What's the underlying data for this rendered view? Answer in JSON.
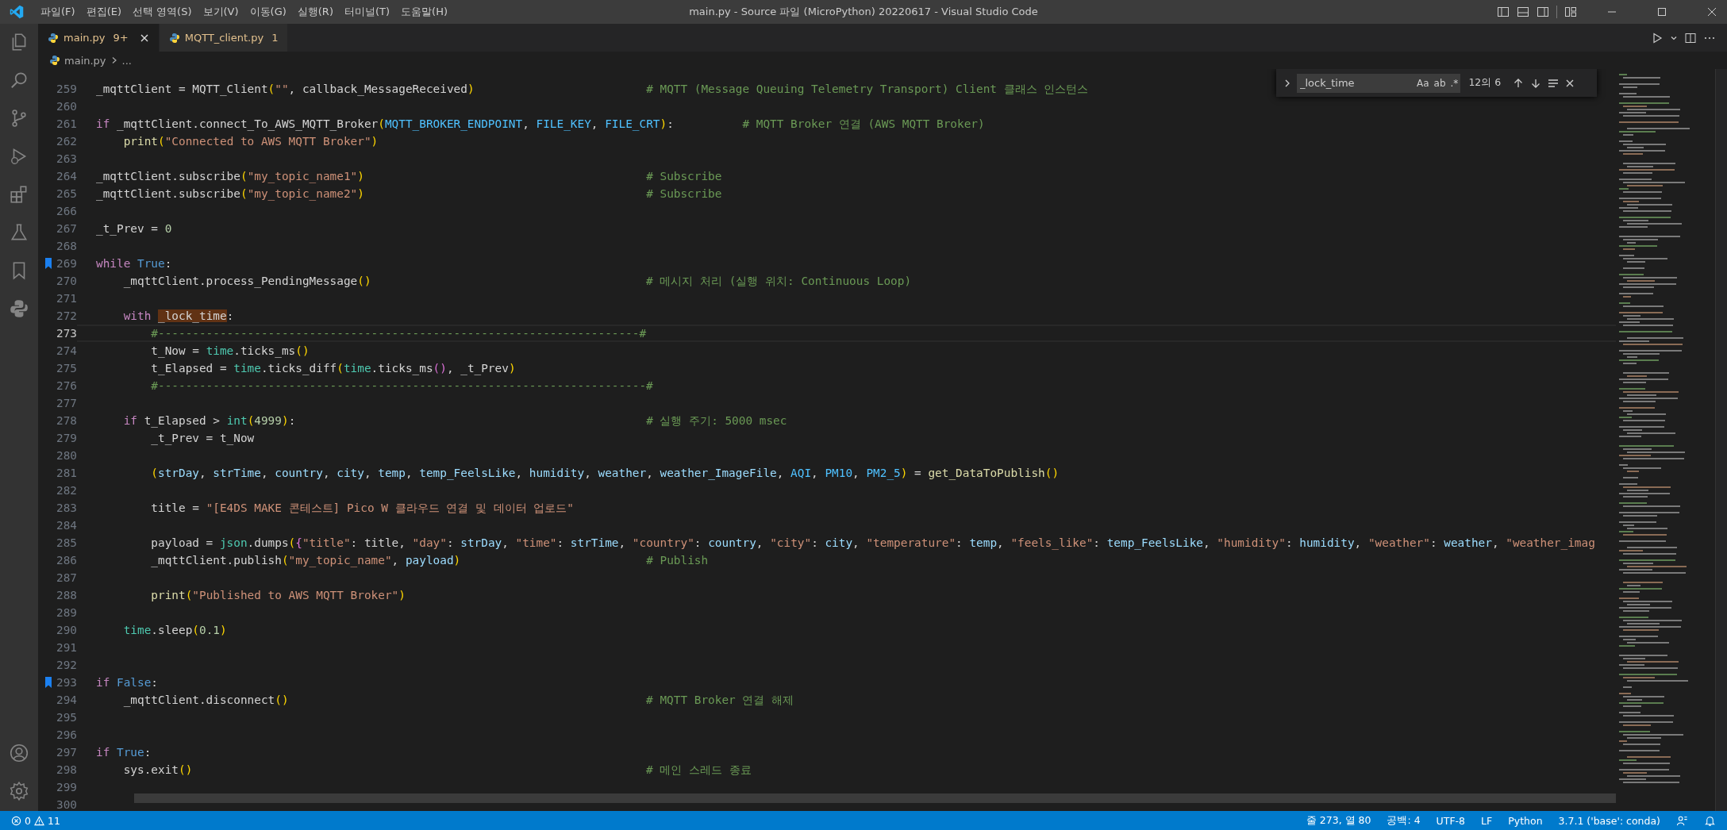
{
  "window": {
    "title": "main.py - Source 파일 (MicroPython) 20220617 - Visual Studio Code"
  },
  "menu": [
    "파일(F)",
    "편집(E)",
    "선택 영역(S)",
    "보기(V)",
    "이동(G)",
    "실행(R)",
    "터미널(T)",
    "도움말(H)"
  ],
  "tabs": [
    {
      "label": "main.py",
      "badge": "9+",
      "selected": true
    },
    {
      "label": "MQTT_client.py",
      "badge": "1",
      "selected": false
    }
  ],
  "breadcrumb": [
    "main.py",
    "..."
  ],
  "find": {
    "value": "_lock_time",
    "options": [
      "Aa",
      "ab",
      ".*"
    ],
    "result": "12의 6"
  },
  "editor": {
    "lines": [
      {
        "number": "259",
        "current": false,
        "bookmarked": false,
        "tokens": [
          {
            "kind": "plain",
            "text": "_mqttClient = MQTT_Client"
          },
          {
            "kind": "p1",
            "text": "("
          },
          {
            "kind": "str",
            "text": "\"\""
          },
          {
            "kind": "plain",
            "text": ", callback_MessageReceived"
          },
          {
            "kind": "p1",
            "text": ")"
          }
        ],
        "comment": "# MQTT (Message Queuing Telemetry Transport) Client 클래스 인스턴스"
      },
      {
        "number": "260",
        "current": false,
        "bookmarked": false
      },
      {
        "number": "261",
        "current": false,
        "bookmarked": false,
        "tokens": [
          {
            "kind": "kw",
            "text": "if"
          },
          {
            "kind": "plain",
            "text": " _mqttClient.connect_To_AWS_MQTT_Broker"
          },
          {
            "kind": "p1",
            "text": "("
          },
          {
            "kind": "konst",
            "text": "MQTT_BROKER_ENDPOINT"
          },
          {
            "kind": "plain",
            "text": ", "
          },
          {
            "kind": "konst",
            "text": "FILE_KEY"
          },
          {
            "kind": "plain",
            "text": ", "
          },
          {
            "kind": "konst",
            "text": "FILE_CRT"
          },
          {
            "kind": "p1",
            "text": ")"
          },
          {
            "kind": "plain",
            "text": ":"
          }
        ],
        "comment": "# MQTT Broker 연결 (AWS MQTT Broker)"
      },
      {
        "number": "262",
        "current": false,
        "bookmarked": false,
        "tokens": [
          {
            "kind": "fn",
            "text": "    print"
          },
          {
            "kind": "p1",
            "text": "("
          },
          {
            "kind": "str",
            "text": "\"Connected to AWS MQTT Broker\""
          },
          {
            "kind": "p1",
            "text": ")"
          }
        ]
      },
      {
        "number": "263",
        "current": false,
        "bookmarked": false
      },
      {
        "number": "264",
        "current": false,
        "bookmarked": false,
        "tokens": [
          {
            "kind": "plain",
            "text": "_mqttClient.subscribe"
          },
          {
            "kind": "p1",
            "text": "("
          },
          {
            "kind": "str",
            "text": "\"my_topic_name1\""
          },
          {
            "kind": "p1",
            "text": ")"
          }
        ],
        "comment": "# Subscribe"
      },
      {
        "number": "265",
        "current": false,
        "bookmarked": false,
        "tokens": [
          {
            "kind": "plain",
            "text": "_mqttClient.subscribe"
          },
          {
            "kind": "p1",
            "text": "("
          },
          {
            "kind": "str",
            "text": "\"my_topic_name2\""
          },
          {
            "kind": "p1",
            "text": ")"
          }
        ],
        "comment": "# Subscribe"
      },
      {
        "number": "266",
        "current": false,
        "bookmarked": false
      },
      {
        "number": "267",
        "current": false,
        "bookmarked": false,
        "tokens": [
          {
            "kind": "plain",
            "text": "_t_Prev = "
          },
          {
            "kind": "num",
            "text": "0"
          }
        ]
      },
      {
        "number": "268",
        "current": false,
        "bookmarked": false
      },
      {
        "number": "269",
        "current": false,
        "bookmarked": true,
        "tokens": [
          {
            "kind": "kw",
            "text": "while "
          },
          {
            "kind": "const",
            "text": "True"
          },
          {
            "kind": "plain",
            "text": ":"
          }
        ]
      },
      {
        "number": "270",
        "current": false,
        "bookmarked": false,
        "tokens": [
          {
            "kind": "plain",
            "text": "    _mqttClient.process_PendingMessage"
          },
          {
            "kind": "p1",
            "text": "()"
          }
        ],
        "comment": "# 메시지 처리 (실행 위치: Continuous Loop)"
      },
      {
        "number": "271",
        "current": false,
        "bookmarked": false
      },
      {
        "number": "272",
        "current": false,
        "bookmarked": false,
        "tokens": [
          {
            "kind": "kw",
            "text": "    with "
          },
          {
            "kind": "match",
            "text": "_lock_time"
          },
          {
            "kind": "plain",
            "text": ":"
          }
        ]
      },
      {
        "number": "273",
        "current": true,
        "bookmarked": false,
        "tokens": [
          {
            "kind": "cmt",
            "text": "        #----------------------------------------------------------------------#"
          }
        ]
      },
      {
        "number": "274",
        "current": false,
        "bookmarked": false,
        "tokens": [
          {
            "kind": "plain",
            "text": "        t_Now = "
          },
          {
            "kind": "cls",
            "text": "time"
          },
          {
            "kind": "plain",
            "text": ".ticks_ms"
          },
          {
            "kind": "p1",
            "text": "()"
          }
        ]
      },
      {
        "number": "275",
        "current": false,
        "bookmarked": false,
        "tokens": [
          {
            "kind": "plain",
            "text": "        t_Elapsed = "
          },
          {
            "kind": "cls",
            "text": "time"
          },
          {
            "kind": "plain",
            "text": ".ticks_diff"
          },
          {
            "kind": "p1",
            "text": "("
          },
          {
            "kind": "cls",
            "text": "time"
          },
          {
            "kind": "plain",
            "text": ".ticks_ms"
          },
          {
            "kind": "p2",
            "text": "()"
          },
          {
            "kind": "plain",
            "text": ", _t_Prev"
          },
          {
            "kind": "p1",
            "text": ")"
          }
        ]
      },
      {
        "number": "276",
        "current": false,
        "bookmarked": false,
        "tokens": [
          {
            "kind": "cmt",
            "text": "        #-----------------------------------------------------------------------#"
          }
        ]
      },
      {
        "number": "277",
        "current": false,
        "bookmarked": false
      },
      {
        "number": "278",
        "current": false,
        "bookmarked": false,
        "tokens": [
          {
            "kind": "kw",
            "text": "    if"
          },
          {
            "kind": "plain",
            "text": " t_Elapsed > "
          },
          {
            "kind": "cls",
            "text": "int"
          },
          {
            "kind": "p1",
            "text": "("
          },
          {
            "kind": "num",
            "text": "4999"
          },
          {
            "kind": "p1",
            "text": ")"
          },
          {
            "kind": "plain",
            "text": ":"
          }
        ],
        "comment": "# 실행 주기: 5000 msec"
      },
      {
        "number": "279",
        "current": false,
        "bookmarked": false,
        "tokens": [
          {
            "kind": "plain",
            "text": "        _t_Prev = t_Now"
          }
        ]
      },
      {
        "number": "280",
        "current": false,
        "bookmarked": false
      },
      {
        "number": "281",
        "current": false,
        "bookmarked": false,
        "tokens": [
          {
            "kind": "p1",
            "text": "        ("
          },
          {
            "kind": "var",
            "text": "strDay"
          },
          {
            "kind": "plain",
            "text": ", "
          },
          {
            "kind": "var",
            "text": "strTime"
          },
          {
            "kind": "plain",
            "text": ", "
          },
          {
            "kind": "var",
            "text": "country"
          },
          {
            "kind": "plain",
            "text": ", "
          },
          {
            "kind": "var",
            "text": "city"
          },
          {
            "kind": "plain",
            "text": ", "
          },
          {
            "kind": "var",
            "text": "temp"
          },
          {
            "kind": "plain",
            "text": ", "
          },
          {
            "kind": "var",
            "text": "temp_FeelsLike"
          },
          {
            "kind": "plain",
            "text": ", "
          },
          {
            "kind": "var",
            "text": "humidity"
          },
          {
            "kind": "plain",
            "text": ", "
          },
          {
            "kind": "var",
            "text": "weather"
          },
          {
            "kind": "plain",
            "text": ", "
          },
          {
            "kind": "var",
            "text": "weather_ImageFile"
          },
          {
            "kind": "plain",
            "text": ", "
          },
          {
            "kind": "konst",
            "text": "AQI"
          },
          {
            "kind": "plain",
            "text": ", "
          },
          {
            "kind": "konst",
            "text": "PM10"
          },
          {
            "kind": "plain",
            "text": ", "
          },
          {
            "kind": "konst",
            "text": "PM2_5"
          },
          {
            "kind": "p1",
            "text": ")"
          },
          {
            "kind": "plain",
            "text": " = "
          },
          {
            "kind": "fn",
            "text": "get_DataToPublish"
          },
          {
            "kind": "p1",
            "text": "()"
          }
        ]
      },
      {
        "number": "282",
        "current": false,
        "bookmarked": false
      },
      {
        "number": "283",
        "current": false,
        "bookmarked": false,
        "tokens": [
          {
            "kind": "plain",
            "text": "        title = "
          },
          {
            "kind": "str",
            "text": "\"[E4DS MAKE 콘테스트] Pico W 클라우드 연결 및 데이터 업로드\""
          }
        ]
      },
      {
        "number": "284",
        "current": false,
        "bookmarked": false
      },
      {
        "number": "285",
        "current": false,
        "bookmarked": false,
        "tokens": [
          {
            "kind": "plain",
            "text": "        payload = "
          },
          {
            "kind": "cls",
            "text": "json"
          },
          {
            "kind": "plain",
            "text": ".dumps"
          },
          {
            "kind": "p1",
            "text": "("
          },
          {
            "kind": "p2",
            "text": "{"
          },
          {
            "kind": "str",
            "text": "\"title\""
          },
          {
            "kind": "plain",
            "text": ": title, "
          },
          {
            "kind": "str",
            "text": "\"day\""
          },
          {
            "kind": "plain",
            "text": ": "
          },
          {
            "kind": "var",
            "text": "strDay"
          },
          {
            "kind": "plain",
            "text": ", "
          },
          {
            "kind": "str",
            "text": "\"time\""
          },
          {
            "kind": "plain",
            "text": ": "
          },
          {
            "kind": "var",
            "text": "strTime"
          },
          {
            "kind": "plain",
            "text": ", "
          },
          {
            "kind": "str",
            "text": "\"country\""
          },
          {
            "kind": "plain",
            "text": ": "
          },
          {
            "kind": "var",
            "text": "country"
          },
          {
            "kind": "plain",
            "text": ", "
          },
          {
            "kind": "str",
            "text": "\"city\""
          },
          {
            "kind": "plain",
            "text": ": "
          },
          {
            "kind": "var",
            "text": "city"
          },
          {
            "kind": "plain",
            "text": ", "
          },
          {
            "kind": "str",
            "text": "\"temperature\""
          },
          {
            "kind": "plain",
            "text": ": "
          },
          {
            "kind": "var",
            "text": "temp"
          },
          {
            "kind": "plain",
            "text": ", "
          },
          {
            "kind": "str",
            "text": "\"feels_like\""
          },
          {
            "kind": "plain",
            "text": ": "
          },
          {
            "kind": "var",
            "text": "temp_FeelsLike"
          },
          {
            "kind": "plain",
            "text": ", "
          },
          {
            "kind": "str",
            "text": "\"humidity\""
          },
          {
            "kind": "plain",
            "text": ": "
          },
          {
            "kind": "var",
            "text": "humidity"
          },
          {
            "kind": "plain",
            "text": ", "
          },
          {
            "kind": "str",
            "text": "\"weather\""
          },
          {
            "kind": "plain",
            "text": ": "
          },
          {
            "kind": "var",
            "text": "weather"
          },
          {
            "kind": "plain",
            "text": ", "
          },
          {
            "kind": "str",
            "text": "\"weather_imag"
          }
        ]
      },
      {
        "number": "286",
        "current": false,
        "bookmarked": false,
        "tokens": [
          {
            "kind": "plain",
            "text": "        _mqttClient.publish"
          },
          {
            "kind": "p1",
            "text": "("
          },
          {
            "kind": "str",
            "text": "\"my_topic_name\""
          },
          {
            "kind": "plain",
            "text": ", "
          },
          {
            "kind": "var",
            "text": "payload"
          },
          {
            "kind": "p1",
            "text": ")"
          }
        ],
        "comment": "# Publish"
      },
      {
        "number": "287",
        "current": false,
        "bookmarked": false
      },
      {
        "number": "288",
        "current": false,
        "bookmarked": false,
        "tokens": [
          {
            "kind": "fn",
            "text": "        print"
          },
          {
            "kind": "p1",
            "text": "("
          },
          {
            "kind": "str",
            "text": "\"Published to AWS MQTT Broker\""
          },
          {
            "kind": "p1",
            "text": ")"
          }
        ]
      },
      {
        "number": "289",
        "current": false,
        "bookmarked": false
      },
      {
        "number": "290",
        "current": false,
        "bookmarked": false,
        "tokens": [
          {
            "kind": "cls",
            "text": "    time"
          },
          {
            "kind": "plain",
            "text": ".sleep"
          },
          {
            "kind": "p1",
            "text": "("
          },
          {
            "kind": "num",
            "text": "0.1"
          },
          {
            "kind": "p1",
            "text": ")"
          }
        ]
      },
      {
        "number": "291",
        "current": false,
        "bookmarked": false
      },
      {
        "number": "292",
        "current": false,
        "bookmarked": false
      },
      {
        "number": "293",
        "current": false,
        "bookmarked": true,
        "tokens": [
          {
            "kind": "kw",
            "text": "if "
          },
          {
            "kind": "const",
            "text": "False"
          },
          {
            "kind": "plain",
            "text": ":"
          }
        ]
      },
      {
        "number": "294",
        "current": false,
        "bookmarked": false,
        "tokens": [
          {
            "kind": "plain",
            "text": "    _mqttClient.disconnect"
          },
          {
            "kind": "p1",
            "text": "()"
          }
        ],
        "comment": "# MQTT Broker 연결 해제"
      },
      {
        "number": "295",
        "current": false,
        "bookmarked": false
      },
      {
        "number": "296",
        "current": false,
        "bookmarked": false
      },
      {
        "number": "297",
        "current": false,
        "bookmarked": false,
        "tokens": [
          {
            "kind": "kw",
            "text": "if "
          },
          {
            "kind": "const",
            "text": "True"
          },
          {
            "kind": "plain",
            "text": ":"
          }
        ]
      },
      {
        "number": "298",
        "current": false,
        "bookmarked": false,
        "tokens": [
          {
            "kind": "plain",
            "text": "    sys.exit"
          },
          {
            "kind": "p1",
            "text": "()"
          }
        ],
        "comment": "# 메인 스레드 종료"
      },
      {
        "number": "299",
        "current": false,
        "bookmarked": false
      },
      {
        "number": "300",
        "current": false,
        "bookmarked": false
      }
    ]
  },
  "status_bar": {
    "errors": "0",
    "warnings": "11",
    "items": [
      "줄 273, 열 80",
      "공백: 4",
      "UTF-8",
      "LF",
      "Python",
      "3.7.1 ('base': conda)"
    ]
  }
}
